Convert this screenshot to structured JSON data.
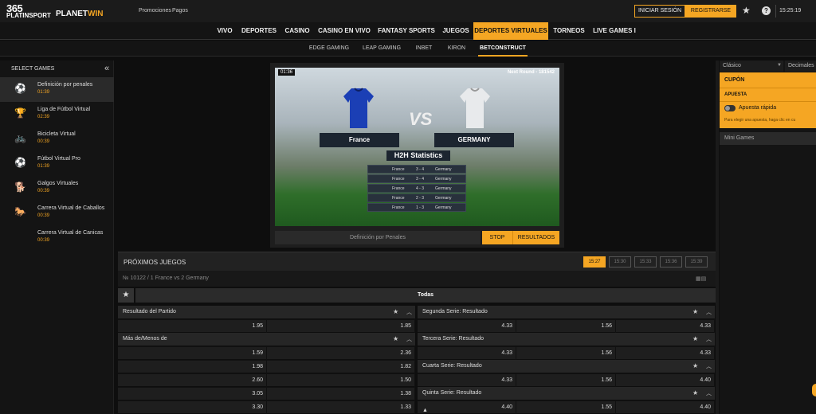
{
  "brand": {
    "logo_top": "365",
    "logo_bottom": "PLATINSPORT",
    "partner_prefix": "PLANET",
    "partner_suffix": "WIN"
  },
  "top": {
    "links": [
      "Promociones",
      "Pagos"
    ],
    "login": "INICIAR SESIÓN",
    "register": "REGISTRARSE",
    "time": "15:25:19"
  },
  "nav": {
    "items": [
      "VIVO",
      "DEPORTES",
      "CASINO",
      "CASINO EN VIVO",
      "FANTASY SPORTS",
      "JUEGOS",
      "DEPORTES VIRTUALES",
      "TORNEOS",
      "LIVE GAMES I"
    ],
    "active_index": 6
  },
  "subnav": {
    "items": [
      "EDGE GAMING",
      "LEAP GAMING",
      "INBET",
      "KIRON",
      "BETCONSTRUCT"
    ],
    "active_index": 4
  },
  "sidebar": {
    "title": "SELECT GAMES",
    "items": [
      {
        "name": "Definición por penales",
        "time": "01:39",
        "icon": "penalty-icon"
      },
      {
        "name": "Liga de Fútbol Virtual",
        "time": "02:39",
        "icon": "trophy-icon"
      },
      {
        "name": "Bicicleta Virtual",
        "time": "00:39",
        "icon": "bicycle-icon"
      },
      {
        "name": "Fútbol Virtual Pro",
        "time": "01:39",
        "icon": "football-icon"
      },
      {
        "name": "Galgos Virtuales",
        "time": "00:39",
        "icon": "greyhound-icon"
      },
      {
        "name": "Carrera Virtual de Caballos",
        "time": "00:39",
        "icon": "horse-icon"
      },
      {
        "name": "Carrera Virtual de Canicas",
        "time": "00:39",
        "icon": "marbles-icon"
      }
    ]
  },
  "video": {
    "timer": "01:36",
    "next_round": "Next Round - 181542",
    "team_home": "France",
    "team_away": "GERMANY",
    "vs": "VS",
    "stats_title": "H2H Statistics",
    "stats": [
      {
        "home": "France",
        "score": "3 - 4",
        "away": "Germany"
      },
      {
        "home": "France",
        "score": "3 - 4",
        "away": "Germany"
      },
      {
        "home": "France",
        "score": "4 - 3",
        "away": "Germany"
      },
      {
        "home": "France",
        "score": "2 - 3",
        "away": "Germany"
      },
      {
        "home": "France",
        "score": "1 - 3",
        "away": "Germany"
      }
    ],
    "label": "Definición por Penales",
    "stop": "STOP",
    "results": "RESULTADOS"
  },
  "betslip": {
    "format_left": "Clásico",
    "format_right": "Decimales",
    "coupon": "CUPÓN",
    "bet": "APUESTA",
    "quick_bet": "Apuesta rápida",
    "hint": "Para elegir una apuesta, haga clic en cu",
    "mini_games": "Mini Games"
  },
  "upcoming": {
    "title": "PRÓXIMOS JUEGOS",
    "times": [
      "15:27",
      "15:30",
      "15:33",
      "15:36",
      "15:39"
    ],
    "active_time": 0,
    "match": "№ 10122 / 1 France vs 2 Germany",
    "filter_all": "Todas"
  },
  "markets_left": [
    {
      "title": "Resultado del Partido",
      "rows": [
        [
          "1.95",
          "1.85"
        ]
      ]
    },
    {
      "title": "Más de/Menos de",
      "rows": [
        [
          "1.59",
          "2.36"
        ],
        [
          "1.98",
          "1.82"
        ],
        [
          "2.60",
          "1.50"
        ],
        [
          "3.05",
          "1.38"
        ],
        [
          "3.30",
          "1.33"
        ]
      ]
    }
  ],
  "markets_right": [
    {
      "title": "Segunda Serie: Resultado",
      "rows": [
        [
          "4.33",
          "1.56",
          "4.33"
        ]
      ]
    },
    {
      "title": "Tercera Serie: Resultado",
      "rows": [
        [
          "4.33",
          "1.56",
          "4.33"
        ]
      ]
    },
    {
      "title": "Cuarta Serie: Resultado",
      "rows": [
        [
          "4.33",
          "1.56",
          "4.40"
        ]
      ]
    },
    {
      "title": "Quinta Serie: Resultado",
      "rows": [
        [
          "4.40",
          "1.55",
          "4.40"
        ]
      ]
    }
  ],
  "colors": {
    "accent": "#f5a623",
    "background": "#0e0e0e"
  }
}
